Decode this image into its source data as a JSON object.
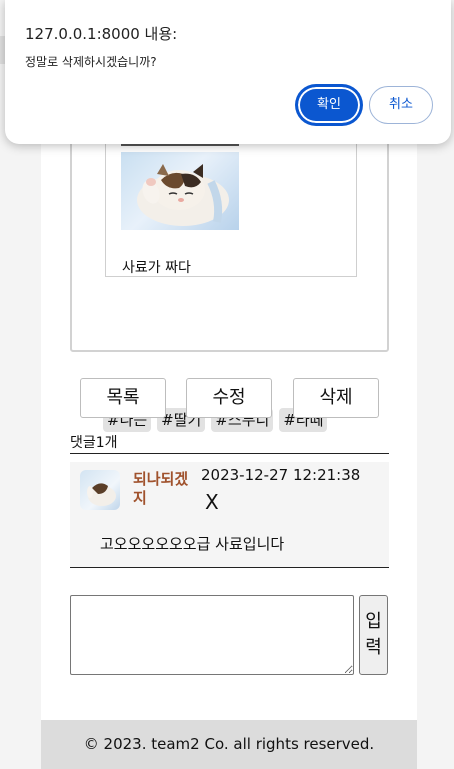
{
  "dialog": {
    "title": "127.0.0.1:8000 내용:",
    "message": "정말로 삭제하시겠습니까?",
    "ok_label": "확인",
    "cancel_label": "취소",
    "accent_color": "#0b57d0"
  },
  "post": {
    "inner_text": "사료가 짜다",
    "image_icon": "cat-photo",
    "tags": [
      "#나는",
      "#딸기",
      "#스무디",
      "#라떼"
    ]
  },
  "actions": {
    "list_label": "목록",
    "edit_label": "수정",
    "delete_label": "삭제"
  },
  "comments": {
    "count_label": "댓글1개",
    "items": [
      {
        "author": "되나되겠지",
        "date": "2023-12-27 12:21:38",
        "delete_label": "X",
        "text": "고오오오오오오급 사료입니다"
      }
    ],
    "submit_label": "입력"
  },
  "footer": {
    "copyright": "© 2023. team2 Co. all rights reserved."
  }
}
